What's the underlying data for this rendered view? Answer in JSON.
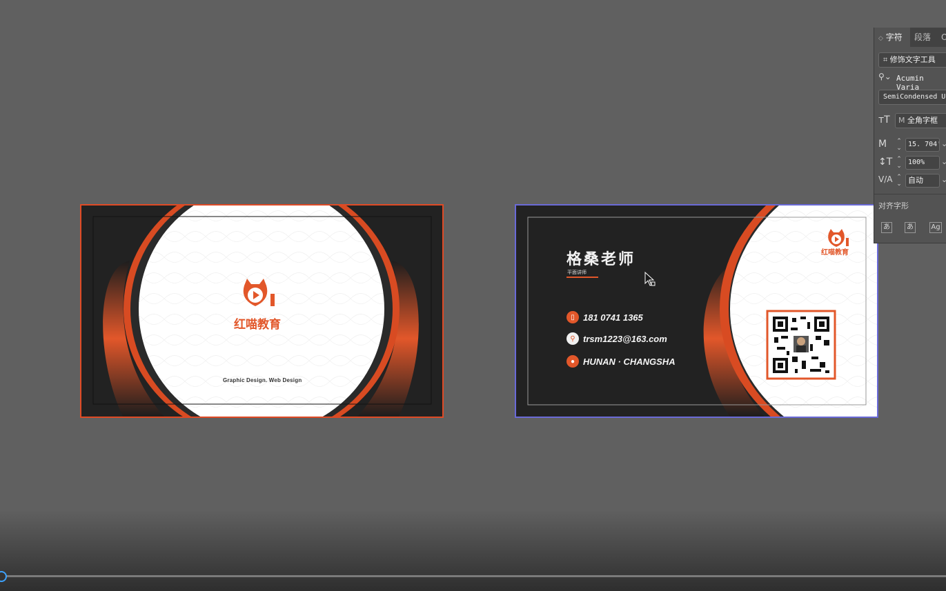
{
  "card_front": {
    "logo_text": "红喵教育",
    "tagline": "Graphic Design.  Web Design"
  },
  "card_back": {
    "name": "格桑老师",
    "title": "平面讲师",
    "logo_text": "红喵教育",
    "contacts": [
      {
        "icon": "phone-icon",
        "text": "181  0741  1365"
      },
      {
        "icon": "link-icon",
        "text": "trsm1223@163.com"
      },
      {
        "icon": "location-pin-icon",
        "text": "HUNAN · CHANGSHA"
      }
    ]
  },
  "panel": {
    "tabs": [
      "字符",
      "段落",
      "O"
    ],
    "touch_type_tool": "修饰文字工具",
    "font_family": "Acumin Varia",
    "font_style": "SemiCondensed Ul",
    "em_box": "全角字框",
    "em_box_glyph": "M",
    "size_value": "15. 704'",
    "vertical_scale": "100%",
    "kerning": "自动",
    "snap_label": "对齐字形"
  },
  "colors": {
    "accent": "#e2572a",
    "dark": "#222222",
    "canvas": "#606060",
    "panel": "#535353"
  }
}
